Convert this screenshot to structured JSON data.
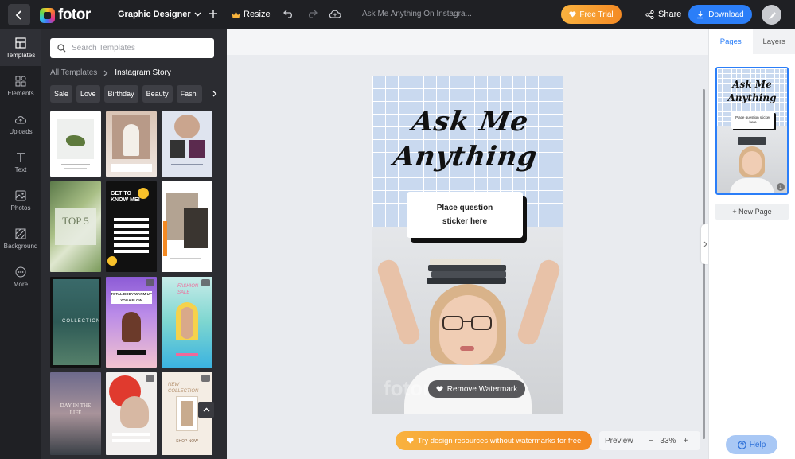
{
  "topbar": {
    "logo_text": "fotor",
    "doc_type": "Graphic Designer",
    "resize_label": "Resize",
    "doc_title": "Ask Me Anything On Instagra...",
    "free_trial_label": "Free Trial",
    "share_label": "Share",
    "download_label": "Download"
  },
  "leftnav": {
    "items": [
      {
        "label": "Templates",
        "icon": "templates-icon"
      },
      {
        "label": "Elements",
        "icon": "elements-icon"
      },
      {
        "label": "Uploads",
        "icon": "upload-icon"
      },
      {
        "label": "Text",
        "icon": "text-icon"
      },
      {
        "label": "Photos",
        "icon": "photos-icon"
      },
      {
        "label": "Background",
        "icon": "background-icon"
      },
      {
        "label": "More",
        "icon": "more-icon"
      }
    ]
  },
  "panel": {
    "search_placeholder": "Search Templates",
    "breadcrumb_root": "All Templates",
    "breadcrumb_current": "Instagram Story",
    "chips": [
      "Sale",
      "Love",
      "Birthday",
      "Beauty",
      "Fashi"
    ],
    "thumb_texts": {
      "top5": "TOP 5",
      "get_to_know": "GET TO KNOW ME!",
      "collection": "COLLECTION",
      "yoga": "TOTAL BODY WARM UP YOGA FLOW",
      "fashion_sale": "FASHION SALE",
      "day_in_life": "DAY IN THE LIFE",
      "new_collection": "NEW COLLECTION",
      "shop_now": "SHOP NOW"
    }
  },
  "design": {
    "headline_line1": "Ask Me",
    "headline_line2": "Anything",
    "sticker_line1": "Place question",
    "sticker_line2": "sticker here",
    "watermark_text": "fotor",
    "remove_watermark_label": "Remove Watermark"
  },
  "canvas": {
    "promo_text": "Try design resources without watermarks for free",
    "preview_label": "Preview",
    "zoom_minus": "−",
    "zoom_level": "33%",
    "zoom_plus": "+"
  },
  "rightpanel": {
    "tab_pages": "Pages",
    "tab_layers": "Layers",
    "page_number": "1",
    "new_page_label": "+ New Page",
    "thumb_line1": "Ask Me",
    "thumb_line2": "Anything",
    "thumb_sticker": "Place question sticker here"
  },
  "help_label": "Help",
  "colors": {
    "accent_blue": "#2b7ef8",
    "accent_orange": "#f48a24",
    "dark_bg": "#1f2024",
    "panel_bg": "#2b2c31"
  }
}
